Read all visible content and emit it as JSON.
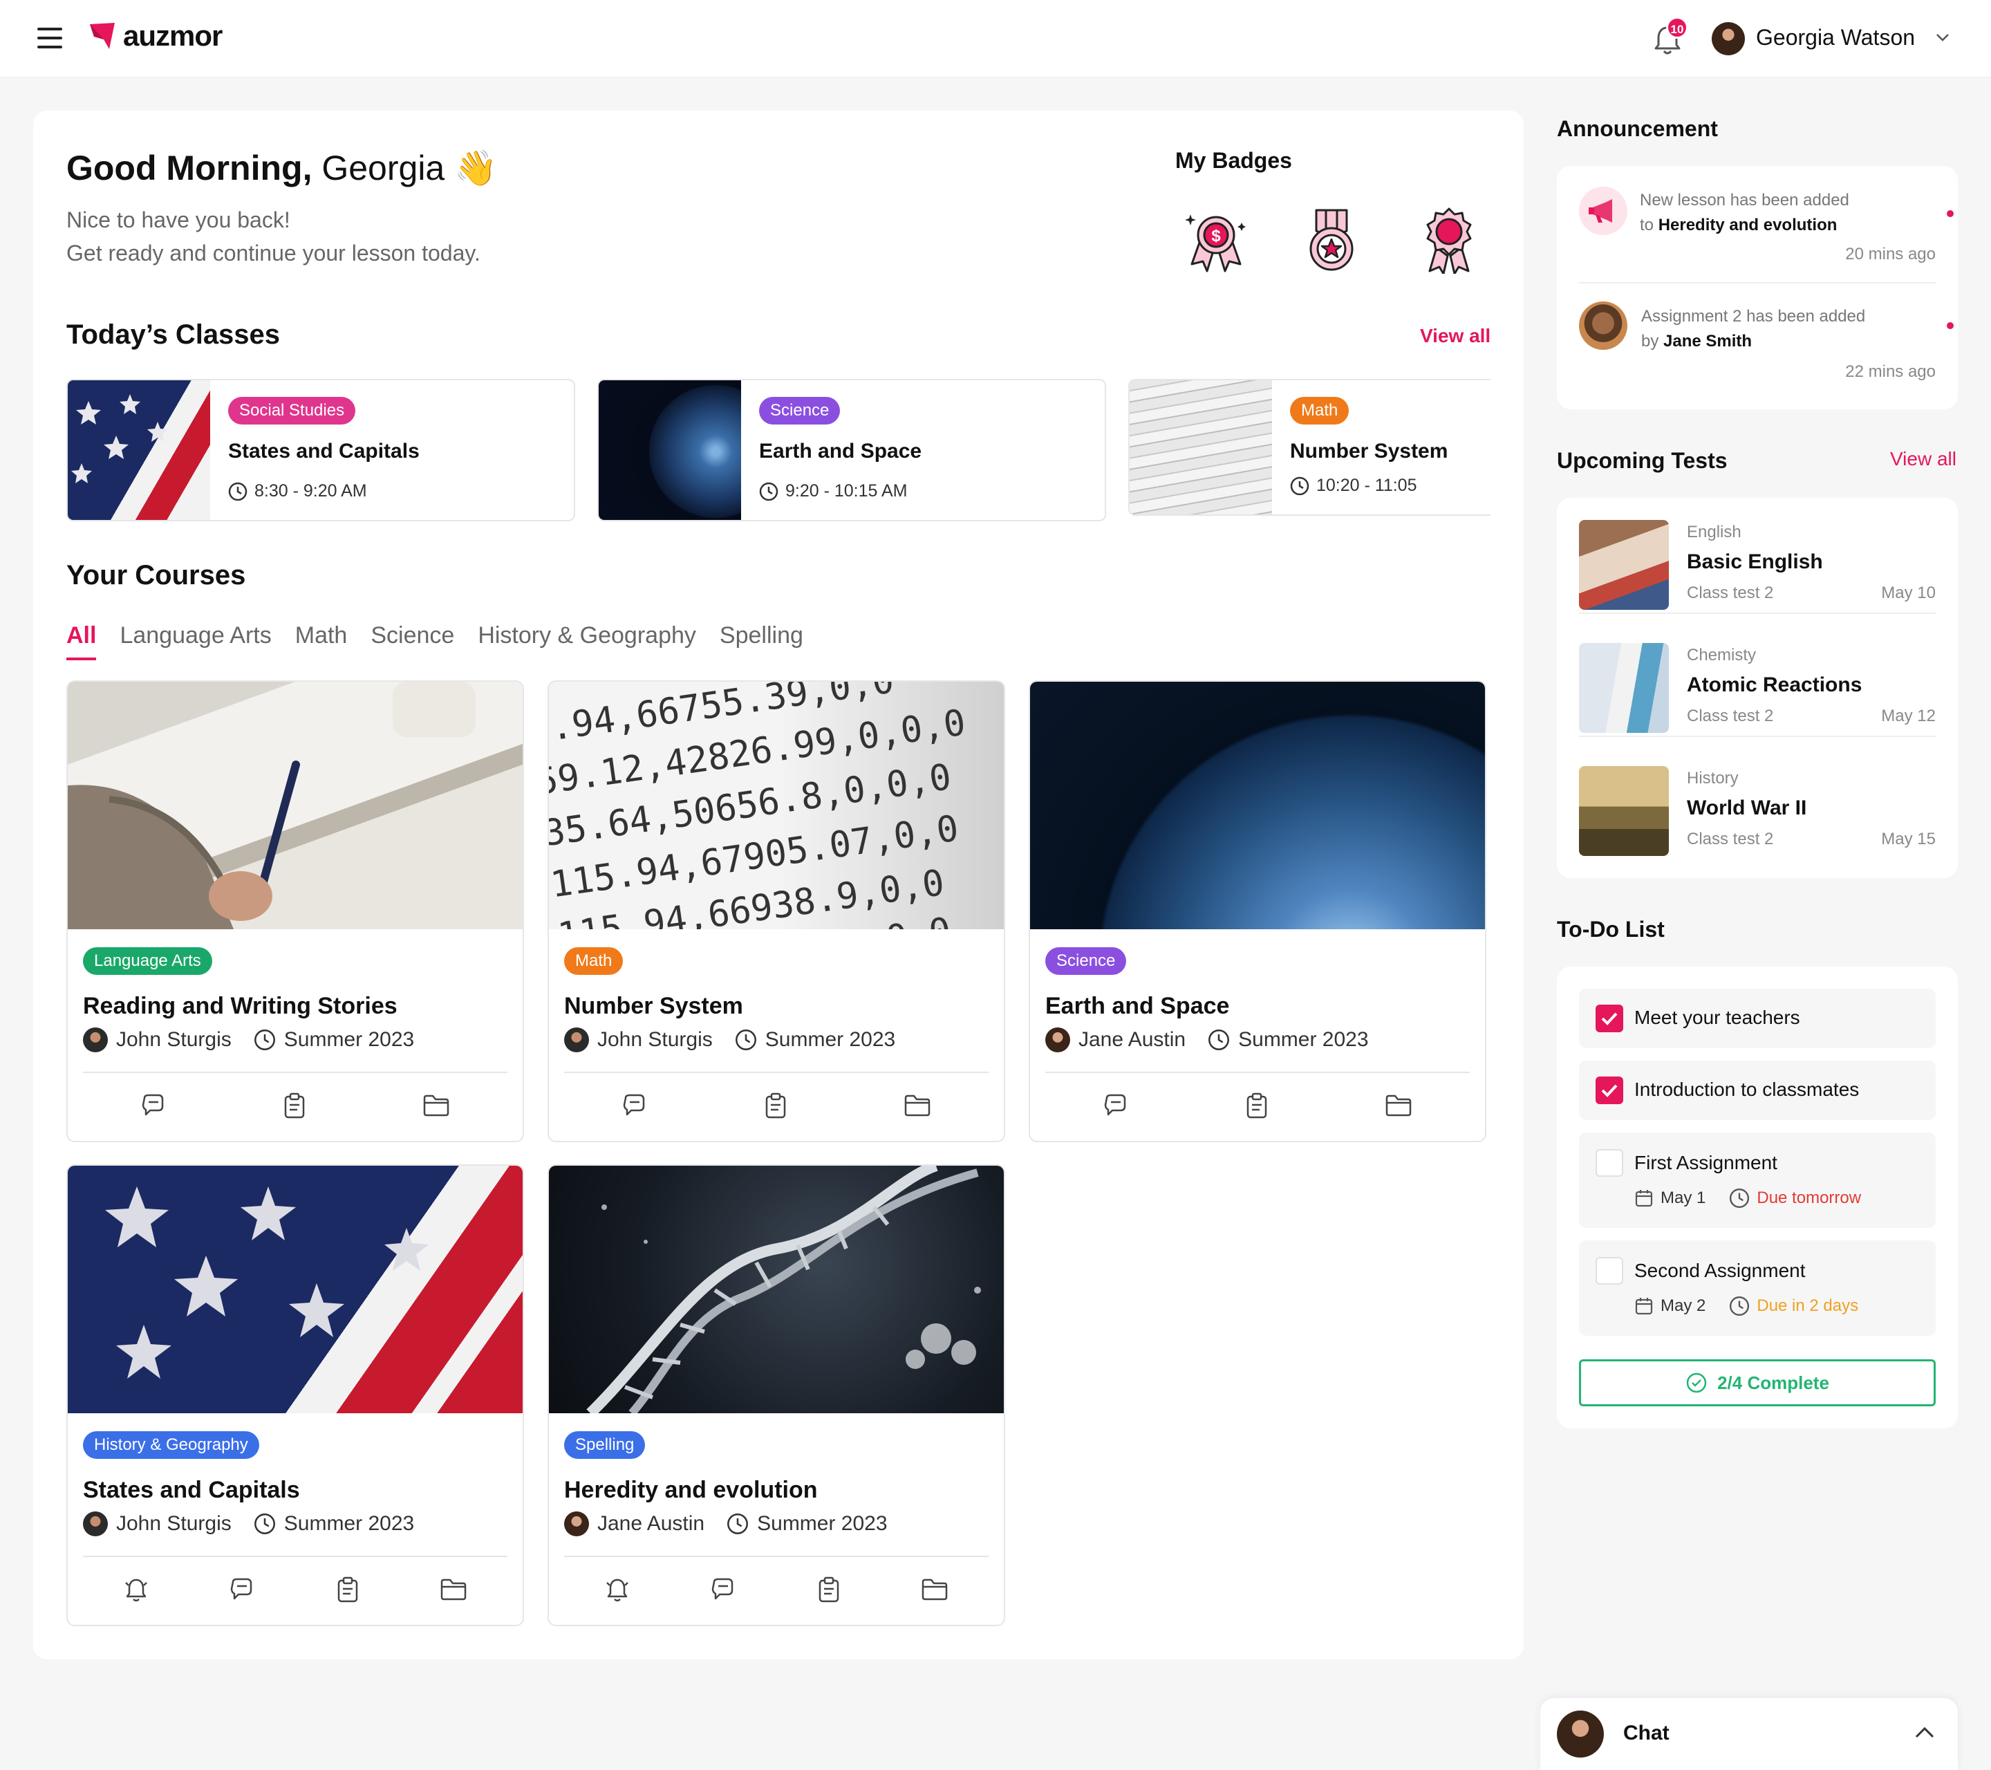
{
  "header": {
    "logo_text": "auzmor",
    "notification_count": "10",
    "user_name": "Georgia Watson",
    "accent_color": "#e5165a"
  },
  "welcome": {
    "greeting_bold": "Good Morning,",
    "greeting_name": " Georgia",
    "greeting_emoji": "👋",
    "line1": "Nice to have you back!",
    "line2": "Get ready and continue your lesson today."
  },
  "badges": {
    "title": "My Badges",
    "icons": [
      "dollar-medal-icon",
      "star-medal-icon",
      "rosette-icon"
    ]
  },
  "todays_classes": {
    "title": "Today’s Classes",
    "view_all": "View all",
    "items": [
      {
        "tag": "Social Studies",
        "tag_color": "#e0358d",
        "name": "States and Capitals",
        "time": "8:30 - 9:20 AM"
      },
      {
        "tag": "Science",
        "tag_color": "#8b4fe0",
        "name": "Earth and Space",
        "time": "9:20 - 10:15 AM"
      },
      {
        "tag": "Math",
        "tag_color": "#f07a1a",
        "name": "Number System",
        "time": "10:20 - 11:05"
      }
    ]
  },
  "courses": {
    "title": "Your Courses",
    "tabs": [
      "All",
      "Language Arts",
      "Math",
      "Science",
      "History & Geography",
      "Spelling"
    ],
    "active_tab": "All",
    "items": [
      {
        "tag": "Language Arts",
        "tag_color": "#1aa86a",
        "name": "Reading and Writing Stories",
        "teacher": "John Sturgis",
        "term": "Summer 2023"
      },
      {
        "tag": "Math",
        "tag_color": "#f07a1a",
        "name": "Number System",
        "teacher": "John Sturgis",
        "term": "Summer 2023"
      },
      {
        "tag": "Science",
        "tag_color": "#8b4fe0",
        "name": "Earth and Space",
        "teacher": "Jane Austin",
        "term": "Summer 2023"
      },
      {
        "tag": "History & Geography",
        "tag_color": "#3b6fe8",
        "name": "States and Capitals",
        "teacher": "John Sturgis",
        "term": "Summer 2023"
      },
      {
        "tag": "Spelling",
        "tag_color": "#3b6fe8",
        "name": "Heredity and evolution",
        "teacher": "Jane Austin",
        "term": "Summer 2023"
      }
    ]
  },
  "announcements": {
    "title": "Announcement",
    "items": [
      {
        "line1": "New lesson has been added",
        "line2_prefix": "to",
        "line2_bold": "Heredity and evolution",
        "time": "20 mins ago"
      },
      {
        "line1": "Assignment 2 has been added",
        "line2_prefix": "by",
        "line2_bold": "Jane Smith",
        "time": "22 mins ago"
      }
    ]
  },
  "upcoming_tests": {
    "title": "Upcoming Tests",
    "view_all": "View all",
    "items": [
      {
        "category": "English",
        "name": "Basic English",
        "sub": "Class test 2",
        "date": "May 10"
      },
      {
        "category": "Chemisty",
        "name": "Atomic Reactions",
        "sub": "Class test 2",
        "date": "May 12"
      },
      {
        "category": "History",
        "name": "World War II",
        "sub": "Class test 2",
        "date": "May 15"
      }
    ]
  },
  "todo": {
    "title": "To-Do List",
    "items": [
      {
        "label": "Meet your teachers",
        "done": true
      },
      {
        "label": "Introduction to classmates",
        "done": true
      },
      {
        "label": "First Assignment",
        "done": false,
        "date": "May 1",
        "due": "Due tomorrow",
        "due_color": "#e53935"
      },
      {
        "label": "Second Assignment",
        "done": false,
        "date": "May 2",
        "due": "Due in 2 days",
        "due_color": "#f0a020"
      }
    ],
    "complete_label": "2/4 Complete"
  },
  "chat": {
    "label": "Chat"
  }
}
